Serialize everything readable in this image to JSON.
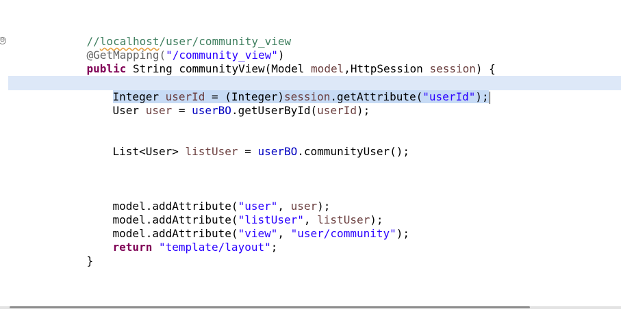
{
  "editor": {
    "fold_marker": "⊖",
    "lines": {
      "l1": {
        "comment_prefix": "//",
        "comment_host": "localhost",
        "comment_path": "/user/community_view"
      },
      "l2": {
        "annotation": "@GetMapping(",
        "mapping": "\"/community_view\"",
        "close": ")"
      },
      "l3": {
        "kw": "public",
        "rest": " String communityView(Model ",
        "param1": "model",
        "sep": ",HttpSession ",
        "param2": "session",
        "end": ") {"
      },
      "l4": {
        "type": "Integer ",
        "var": "userId",
        "eq": " = (Integer)",
        "session": "session",
        "call": ".getAttribute(",
        "arg": "\"userId\"",
        "end": ");"
      },
      "l5": {
        "type": "User ",
        "var": "user",
        "eq": " = ",
        "field": "userBO",
        "call": ".getUserById(",
        "arg": "userId",
        "end": ");"
      },
      "l6": {
        "type": "List<User> ",
        "var": "listUser",
        "eq": " = ",
        "field": "userBO",
        "call": ".communityUser();"
      },
      "l7": {
        "call": "model.addAttribute(",
        "key": "\"user\"",
        "sep": ", ",
        "val": "user",
        "end": ");"
      },
      "l8": {
        "call": "model.addAttribute(",
        "key": "\"listUser\"",
        "sep": ", ",
        "val": "listUser",
        "end": ");"
      },
      "l9": {
        "call": "model.addAttribute(",
        "key": "\"view\"",
        "sep": ", ",
        "val": "\"user/community\"",
        "end": ");"
      },
      "l10": {
        "kw": "return",
        "sp": " ",
        "val": "\"template/layout\"",
        "end": ";"
      },
      "l11": {
        "brace": "}"
      },
      "l12": {
        "brace": "}"
      }
    }
  }
}
